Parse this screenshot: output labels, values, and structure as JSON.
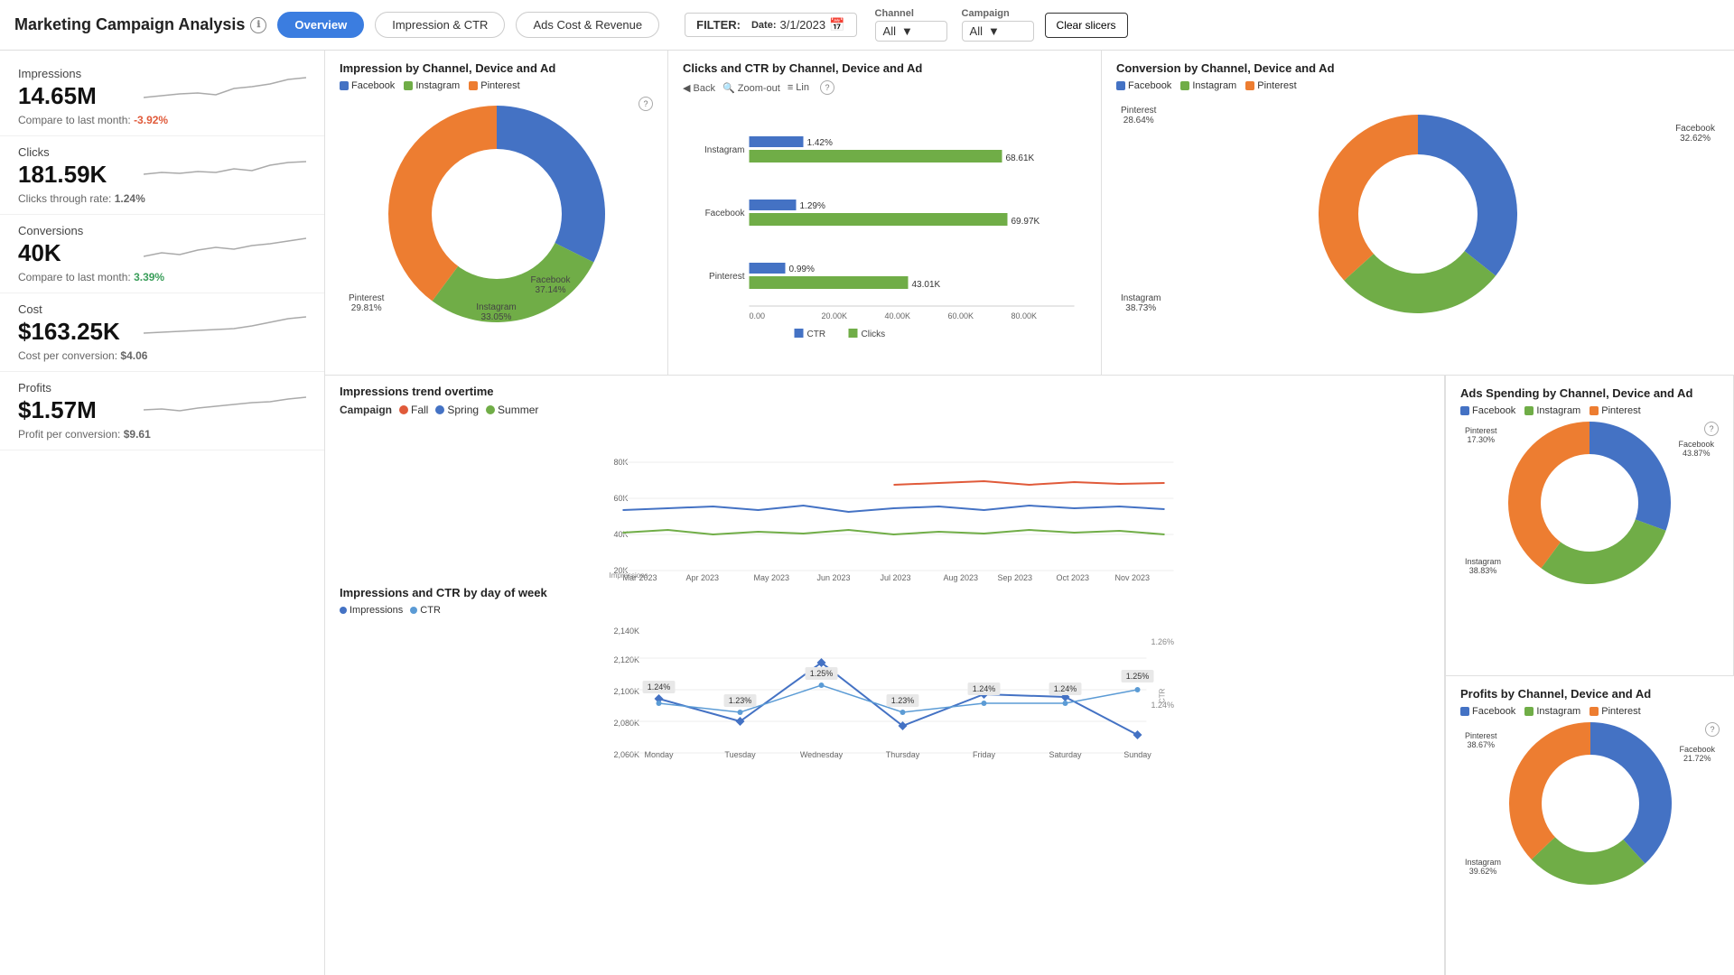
{
  "header": {
    "title": "Marketing Campaign Analysis",
    "nav": {
      "overview": "Overview",
      "impression_ctr": "Impression & CTR",
      "ads_cost_revenue": "Ads Cost & Revenue"
    },
    "filter_label": "FILTER:",
    "date_label": "Date:",
    "date_value": "3/1/2023",
    "channel_label": "Channel",
    "channel_value": "All",
    "campaign_label": "Campaign",
    "campaign_value": "All",
    "clear_label": "Clear slicers"
  },
  "metrics": [
    {
      "label": "Impressions",
      "value": "14.65M",
      "sub_label": "Compare to last month:",
      "sub_value": "-3.92%",
      "sub_type": "negative"
    },
    {
      "label": "Clicks",
      "value": "181.59K",
      "sub_label": "Clicks through rate:",
      "sub_value": "1.24%",
      "sub_type": "neutral"
    },
    {
      "label": "Conversions",
      "value": "40K",
      "sub_label": "Compare to last month:",
      "sub_value": "3.39%",
      "sub_type": "positive"
    },
    {
      "label": "Cost",
      "value": "$163.25K",
      "sub_label": "Cost per conversion:",
      "sub_value": "$4.06",
      "sub_type": "neutral"
    },
    {
      "label": "Profits",
      "value": "$1.57M",
      "sub_label": "Profit per conversion:",
      "sub_value": "$9.61",
      "sub_type": "neutral"
    }
  ],
  "impression_donut": {
    "title": "Impression by Channel, Device and Ad",
    "legend": [
      "Facebook",
      "Instagram",
      "Pinterest"
    ],
    "colors": [
      "#4472c4",
      "#70ad47",
      "#ed7d31"
    ],
    "values": [
      37.14,
      33.05,
      29.81
    ],
    "labels": [
      "Facebook 37.14%",
      "Instagram 33.05%",
      "Pinterest 29.81%"
    ]
  },
  "clicks_ctr": {
    "title": "Clicks and CTR by Channel, Device and Ad",
    "channels": [
      "Instagram",
      "Facebook",
      "Pinterest"
    ],
    "ctr_values": [
      1.42,
      1.29,
      0.99
    ],
    "clicks_values": [
      68610,
      69970,
      43010
    ],
    "ctr_color": "#4472c4",
    "clicks_color": "#70ad47",
    "legend": [
      "CTR",
      "Clicks"
    ]
  },
  "conversion_donut": {
    "title": "Conversion by Channel, Device and Ad",
    "legend": [
      "Facebook",
      "Instagram",
      "Pinterest"
    ],
    "colors": [
      "#4472c4",
      "#70ad47",
      "#ed7d31"
    ],
    "values": [
      32.62,
      38.73,
      28.64
    ],
    "labels": [
      "Facebook 32.62%",
      "Instagram 38.73%",
      "Pinterest 28.64%"
    ]
  },
  "impressions_trend": {
    "title": "Impressions trend overtime",
    "campaign_label": "Campaign",
    "campaigns": [
      "Fall",
      "Spring",
      "Summer"
    ],
    "campaign_colors": [
      "#e05a3a",
      "#4472c4",
      "#70ad47"
    ],
    "x_labels": [
      "Mar 2023",
      "Apr 2023",
      "May 2023",
      "Jun 2023",
      "Jul 2023",
      "Aug 2023",
      "Sep 2023",
      "Oct 2023",
      "Nov 2023"
    ],
    "y_labels": [
      "20K",
      "40K",
      "60K",
      "80K"
    ]
  },
  "dow_chart": {
    "title": "Impressions and CTR by day of week",
    "legend": [
      "Impressions",
      "CTR"
    ],
    "colors": [
      "#4472c4",
      "#5b9bd5"
    ],
    "days": [
      "Monday",
      "Tuesday",
      "Wednesday",
      "Thursday",
      "Friday",
      "Saturday",
      "Sunday"
    ],
    "impressions": [
      2085000,
      2080000,
      2115000,
      2075000,
      2100000,
      2095000,
      2070000
    ],
    "ctr": [
      1.24,
      1.23,
      1.25,
      1.23,
      1.24,
      1.24,
      1.25
    ],
    "ctr_labels": [
      "1.24%",
      "1.23%",
      "1.25%",
      "1.23%",
      "1.24%",
      "1.24%",
      "1.25%"
    ],
    "y_labels": [
      "2,060K",
      "2,080K",
      "2,100K",
      "2,120K",
      "2,140K"
    ],
    "ctr_y_labels": [
      "1.24%",
      "1.26%"
    ]
  },
  "ads_spending": {
    "title": "Ads Spending by Channel, Device and Ad",
    "legend": [
      "Facebook",
      "Instagram",
      "Pinterest"
    ],
    "colors": [
      "#4472c4",
      "#70ad47",
      "#ed7d31"
    ],
    "values": [
      43.87,
      38.83,
      17.3
    ],
    "labels": [
      "Facebook 43.87%",
      "Instagram 38.83%",
      "Pinterest 17.30%"
    ]
  },
  "profits_donut": {
    "title": "Profits by Channel, Device and Ad",
    "legend": [
      "Facebook",
      "Instagram",
      "Pinterest"
    ],
    "colors": [
      "#4472c4",
      "#70ad47",
      "#ed7d31"
    ],
    "values": [
      21.72,
      39.62,
      38.67
    ],
    "labels": [
      "Facebook 21.72%",
      "Instagram 39.62%",
      "Pinterest 38.67%"
    ]
  }
}
